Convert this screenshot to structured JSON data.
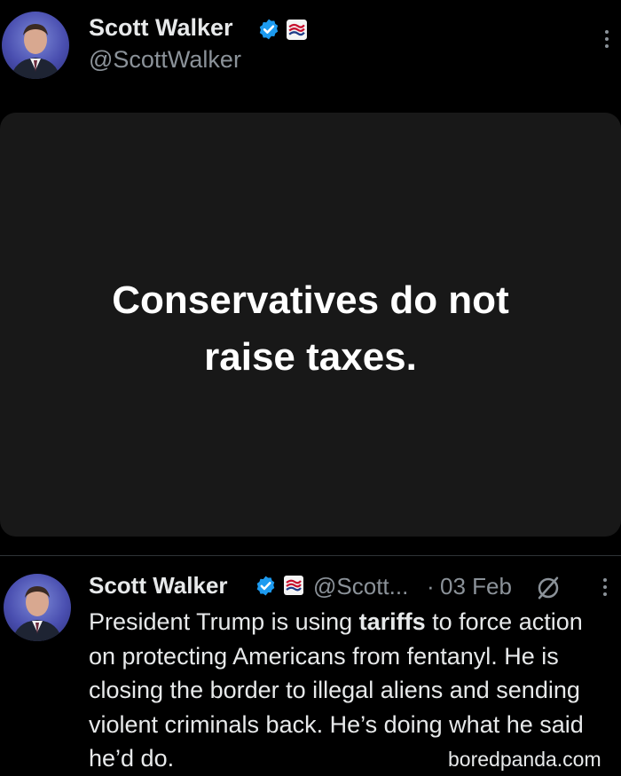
{
  "top_post": {
    "display_name": "Scott Walker",
    "handle": "@ScottWalker",
    "avatar_icon": "profile-photo",
    "verified_icon": "verified-badge-icon",
    "affiliation_icon": "flag-affiliation-icon",
    "more_icon": "more-options-icon",
    "media_text": "Conservatives do not raise taxes."
  },
  "reply": {
    "display_name": "Scott Walker",
    "handle_truncated": "@Scott...",
    "separator": "·",
    "date": "03 Feb",
    "grok_icon": "grok-icon",
    "more_icon": "more-options-icon",
    "text_before": "President Trump is using ",
    "text_bold": "tariffs",
    "text_after": " to force action on protecting Americans from fentanyl. He is closing the border to illegal aliens and sending violent criminals back. He’s doing what he said he’d do."
  },
  "watermark": "boredpanda.com",
  "colors": {
    "background": "#000000",
    "card": "#181818",
    "verified": "#1d9bf0",
    "muted_text": "#8b9299",
    "text": "#e7e9ea"
  }
}
